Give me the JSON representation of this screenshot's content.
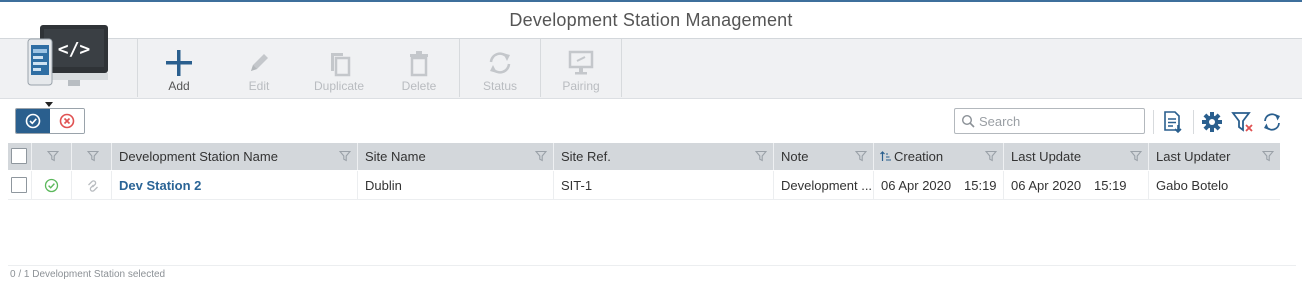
{
  "window": {
    "title": "Development Station Management"
  },
  "toolbar": {
    "app_icon": "dev-station-icon",
    "buttons": [
      {
        "label": "Add",
        "icon": "plus-icon",
        "enabled": true
      },
      {
        "label": "Edit",
        "icon": "pencil-icon",
        "enabled": false
      },
      {
        "label": "Duplicate",
        "icon": "copy-icon",
        "enabled": false
      },
      {
        "label": "Delete",
        "icon": "trash-icon",
        "enabled": false
      },
      {
        "label": "Status",
        "icon": "refresh-cycle-icon",
        "enabled": false
      },
      {
        "label": "Pairing",
        "icon": "monitor-link-icon",
        "enabled": false
      }
    ]
  },
  "filter_toggle": {
    "active": "enabled",
    "icons": [
      "check-circle-icon",
      "x-circle-icon"
    ]
  },
  "search": {
    "placeholder": "Search",
    "value": ""
  },
  "right_tools": [
    "export-list-icon",
    "gear-icon",
    "clear-filter-icon",
    "refresh-icon"
  ],
  "grid": {
    "columns": [
      {
        "label": ""
      },
      {
        "label": ""
      },
      {
        "label": ""
      },
      {
        "label": "Development Station Name"
      },
      {
        "label": "Site Name"
      },
      {
        "label": "Site Ref."
      },
      {
        "label": "Note"
      },
      {
        "label": "Creation",
        "sort": "ascending"
      },
      {
        "label": "Last Update"
      },
      {
        "label": "Last Updater"
      }
    ],
    "rows": [
      {
        "selected": false,
        "status_icon": "check-circle-icon",
        "pairing_icon": "link-icon",
        "name": "Dev Station 2",
        "site_name": "Dublin",
        "site_ref": "SIT-1",
        "note": "Development ...",
        "creation_date": "06 Apr 2020",
        "creation_time": "15:19",
        "last_update_date": "06 Apr 2020",
        "last_update_time": "15:19",
        "last_updater": "Gabo Botelo"
      }
    ]
  },
  "footer": {
    "status": "0 / 1 Development Station selected"
  },
  "colors": {
    "accent": "#2a5f8e",
    "header_bg": "#d3d7db",
    "toolbar_bg": "#f0f1f3",
    "link": "#2a6496",
    "ok_green": "#5cb85c",
    "danger_red": "#e05252"
  }
}
